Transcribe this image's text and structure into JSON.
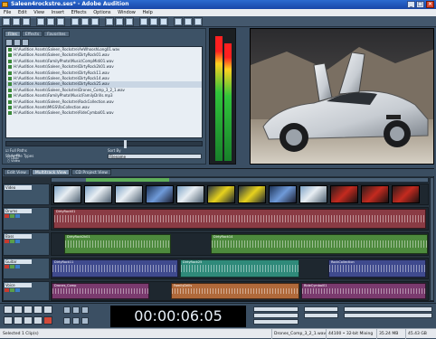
{
  "window": {
    "title": "Saleen4rockstre.ses* - Adobe Audition"
  },
  "menu": [
    "File",
    "Edit",
    "View",
    "Insert",
    "Effects",
    "Options",
    "Window",
    "Help"
  ],
  "left_panel": {
    "tabs": [
      "Files",
      "Effects",
      "Favorites"
    ],
    "files": [
      "H:\\Audition Assets\\Saleen_Rockstre\\AeWhooshLong01.wav",
      "H:\\Audition Assets\\Saleen_Rockstre\\DirtyRock01.wav",
      "H:\\Audition Assets\\FamilyPhoto\\Music\\CompMidi01.wav",
      "H:\\Audition Assets\\Saleen_Rockstre\\DirtyRock2k01.wav",
      "H:\\Audition Assets\\Saleen_Rockstre\\DirtyRock11.wav",
      "H:\\Audition Assets\\Saleen_Rockstre\\DirtyRock14.wav",
      "H:\\Audition Assets\\Saleen_Rockstre\\DirtyRock25.wav",
      "H:\\Audition Assets\\Saleen_Rockstre\\Drones_Comp_3_2_1.wav",
      "H:\\Audition Assets\\FamilyPhoto\\Music\\FamilyDrills.mp3",
      "H:\\Audition Assets\\Saleen_Rockstre\\RockCollection.wav",
      "H:\\Audition Assets\\MIGS\\RaCollection.wav",
      "H:\\Audition Assets\\Saleen_Rockstre\\RideCymbal01.wav"
    ],
    "selected_index": 6,
    "full_paths_label": "Full Paths",
    "autoplay_label": "Auto-Play",
    "show_file_types_label": "Show File Types",
    "file_types": [
      "Audio",
      "Loop",
      "Video",
      "MIDI"
    ],
    "sort_by_label": "Sort By",
    "sort_value": "Filename"
  },
  "editor": {
    "tabs": [
      "Edit View",
      "Multitrack View",
      "CD Project View"
    ],
    "active_tab": 1,
    "tracks": [
      {
        "name": "Video",
        "kind": "video"
      },
      {
        "name": "Drums",
        "kind": "audio"
      },
      {
        "name": "Bass",
        "kind": "audio"
      },
      {
        "name": "Guitar",
        "kind": "audio"
      },
      {
        "name": "Voice",
        "kind": "audio"
      }
    ],
    "clips": {
      "drums": [
        {
          "label": "DirtyRock01"
        }
      ],
      "bass": [
        {
          "label": "DirtyRock2k01"
        },
        {
          "label": "DirtyRock14"
        }
      ],
      "guitar": [
        {
          "label": "DirtyRock11"
        },
        {
          "label": "DirtyRock25"
        },
        {
          "label": "RockCollection"
        }
      ],
      "voice": [
        {
          "label": "Drones_Comp"
        },
        {
          "label": "FamilyDrills"
        },
        {
          "label": "RideCymbal01"
        }
      ]
    }
  },
  "transport": {
    "timecode": "00:00:06:05"
  },
  "statusbar": {
    "selected": "Selected 1 Clip(s)",
    "clip": "Drones_Comp_3_2_1.wav",
    "format": "44100 • 32-bit Mixing",
    "size": "35.24 MB",
    "free": "45.43 GB"
  },
  "colors": {
    "drums_clip": "#7a3b45",
    "bass_clip": "#3d7a3a",
    "guitar_clip": "#3f4a8e",
    "voice_clip": "#7a3a6e",
    "guitar_alt": "#2f8a7a",
    "voice_alt": "#b0693a"
  }
}
